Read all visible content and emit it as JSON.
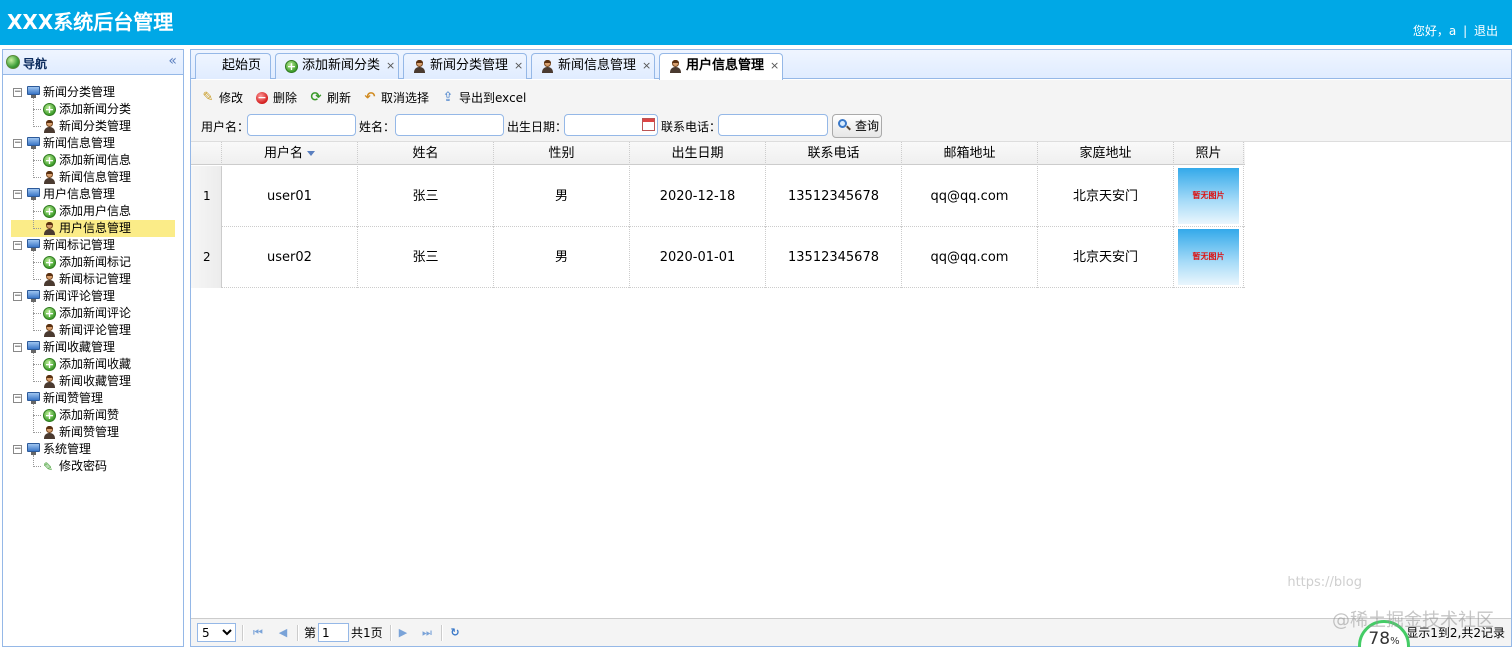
{
  "header": {
    "title": "XXX系统后台管理",
    "greeting": "您好，a",
    "separator": "|",
    "logout": "退出",
    "bg_color": "#00a8e6"
  },
  "nav": {
    "title": "导航",
    "collapse_glyph": "«",
    "groups": [
      {
        "label": "新闻分类管理",
        "items": [
          {
            "label": "添加新闻分类",
            "icon": "plus-icon"
          },
          {
            "label": "新闻分类管理",
            "icon": "user-icon"
          }
        ]
      },
      {
        "label": "新闻信息管理",
        "items": [
          {
            "label": "添加新闻信息",
            "icon": "plus-icon"
          },
          {
            "label": "新闻信息管理",
            "icon": "user-icon"
          }
        ]
      },
      {
        "label": "用户信息管理",
        "items": [
          {
            "label": "添加用户信息",
            "icon": "plus-icon"
          },
          {
            "label": "用户信息管理",
            "icon": "user-icon",
            "selected": true
          }
        ]
      },
      {
        "label": "新闻标记管理",
        "items": [
          {
            "label": "添加新闻标记",
            "icon": "plus-icon"
          },
          {
            "label": "新闻标记管理",
            "icon": "user-icon"
          }
        ]
      },
      {
        "label": "新闻评论管理",
        "items": [
          {
            "label": "添加新闻评论",
            "icon": "plus-icon"
          },
          {
            "label": "新闻评论管理",
            "icon": "user-icon"
          }
        ]
      },
      {
        "label": "新闻收藏管理",
        "items": [
          {
            "label": "添加新闻收藏",
            "icon": "plus-icon"
          },
          {
            "label": "新闻收藏管理",
            "icon": "user-icon"
          }
        ]
      },
      {
        "label": "新闻赞管理",
        "items": [
          {
            "label": "添加新闻赞",
            "icon": "plus-icon"
          },
          {
            "label": "新闻赞管理",
            "icon": "user-icon"
          }
        ]
      },
      {
        "label": "系统管理",
        "items": [
          {
            "label": "修改密码",
            "icon": "pencil-icon"
          }
        ]
      }
    ],
    "selected_color": "#fbec88"
  },
  "tabs": [
    {
      "label": "起始页",
      "icon": "none",
      "closable": false,
      "active": false
    },
    {
      "label": "添加新闻分类",
      "icon": "plus-icon",
      "closable": true,
      "active": false
    },
    {
      "label": "新闻分类管理",
      "icon": "user-icon",
      "closable": true,
      "active": false
    },
    {
      "label": "新闻信息管理",
      "icon": "user-icon",
      "closable": true,
      "active": false
    },
    {
      "label": "用户信息管理",
      "icon": "user-icon",
      "closable": true,
      "active": true
    }
  ],
  "close_glyph": "×",
  "toolbar": {
    "edit": "修改",
    "delete": "删除",
    "refresh": "刷新",
    "deselect": "取消选择",
    "export": "导出到excel"
  },
  "search": {
    "username_label": "用户名：",
    "name_label": "姓名：",
    "birth_label": "出生日期：",
    "phone_label": "联系电话：",
    "button": "查询"
  },
  "grid": {
    "columns": [
      "用户名",
      "姓名",
      "性别",
      "出生日期",
      "联系电话",
      "邮箱地址",
      "家庭地址",
      "照片"
    ],
    "rows": [
      {
        "num": "1",
        "cells": [
          "user01",
          "张三",
          "男",
          "2020-12-18",
          "13512345678",
          "qq@qq.com",
          "北京天安门"
        ],
        "photo_text": "暂无图片"
      },
      {
        "num": "2",
        "cells": [
          "user02",
          "张三",
          "男",
          "2020-01-01",
          "13512345678",
          "qq@qq.com",
          "北京天安门"
        ],
        "photo_text": "暂无图片"
      }
    ]
  },
  "pager": {
    "page_size": "5",
    "page_prefix": "第",
    "page_value": "1",
    "page_total": "共1页",
    "info": "显示1到2,共2记录",
    "first_glyph": "⏮",
    "prev_glyph": "◀",
    "next_glyph": "▶",
    "last_glyph": "⏭",
    "refresh_glyph": "↻"
  },
  "overlay": {
    "gauge_value": "78",
    "gauge_unit": "%",
    "watermark": "@稀土掘金技术社区",
    "url_watermark": "https://blog"
  }
}
